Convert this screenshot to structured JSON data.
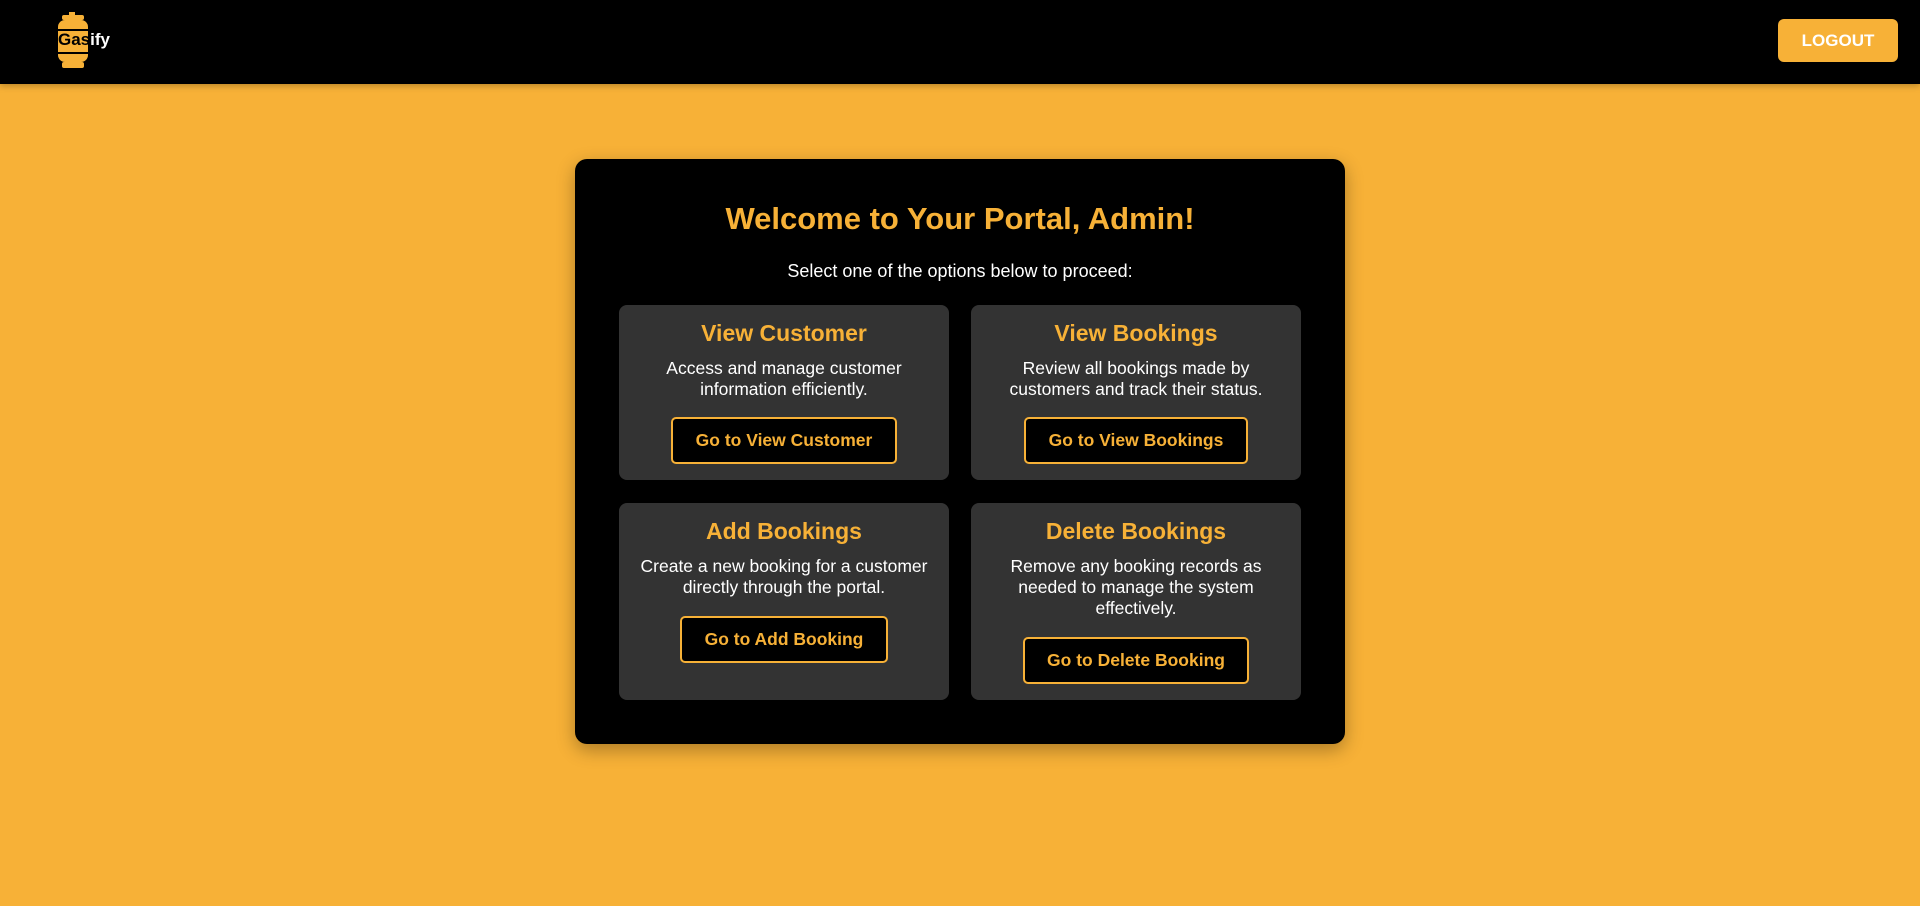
{
  "header": {
    "logo_part1": "Gas",
    "logo_part2": "ify",
    "logo_icon": "gas-cylinder-icon",
    "logout_label": "LOGOUT"
  },
  "portal": {
    "title": "Welcome to Your Portal, Admin!",
    "subtitle": "Select one of the options below to proceed:"
  },
  "cards": [
    {
      "title": "View Customer",
      "description": "Access and manage customer information efficiently.",
      "button": "Go to View Customer"
    },
    {
      "title": "View Bookings",
      "description": "Review all bookings made by customers and track their status.",
      "button": "Go to View Bookings"
    },
    {
      "title": "Add Bookings",
      "description": "Create a new booking for a customer directly through the portal.",
      "button": "Go to Add Booking"
    },
    {
      "title": "Delete Bookings",
      "description": "Remove any booking records as needed to manage the system effectively.",
      "button": "Go to Delete Booking"
    }
  ],
  "colors": {
    "accent": "#f7b137",
    "background": "#f7b137",
    "panel": "#000000",
    "card": "#333333",
    "text": "#ffffff"
  }
}
